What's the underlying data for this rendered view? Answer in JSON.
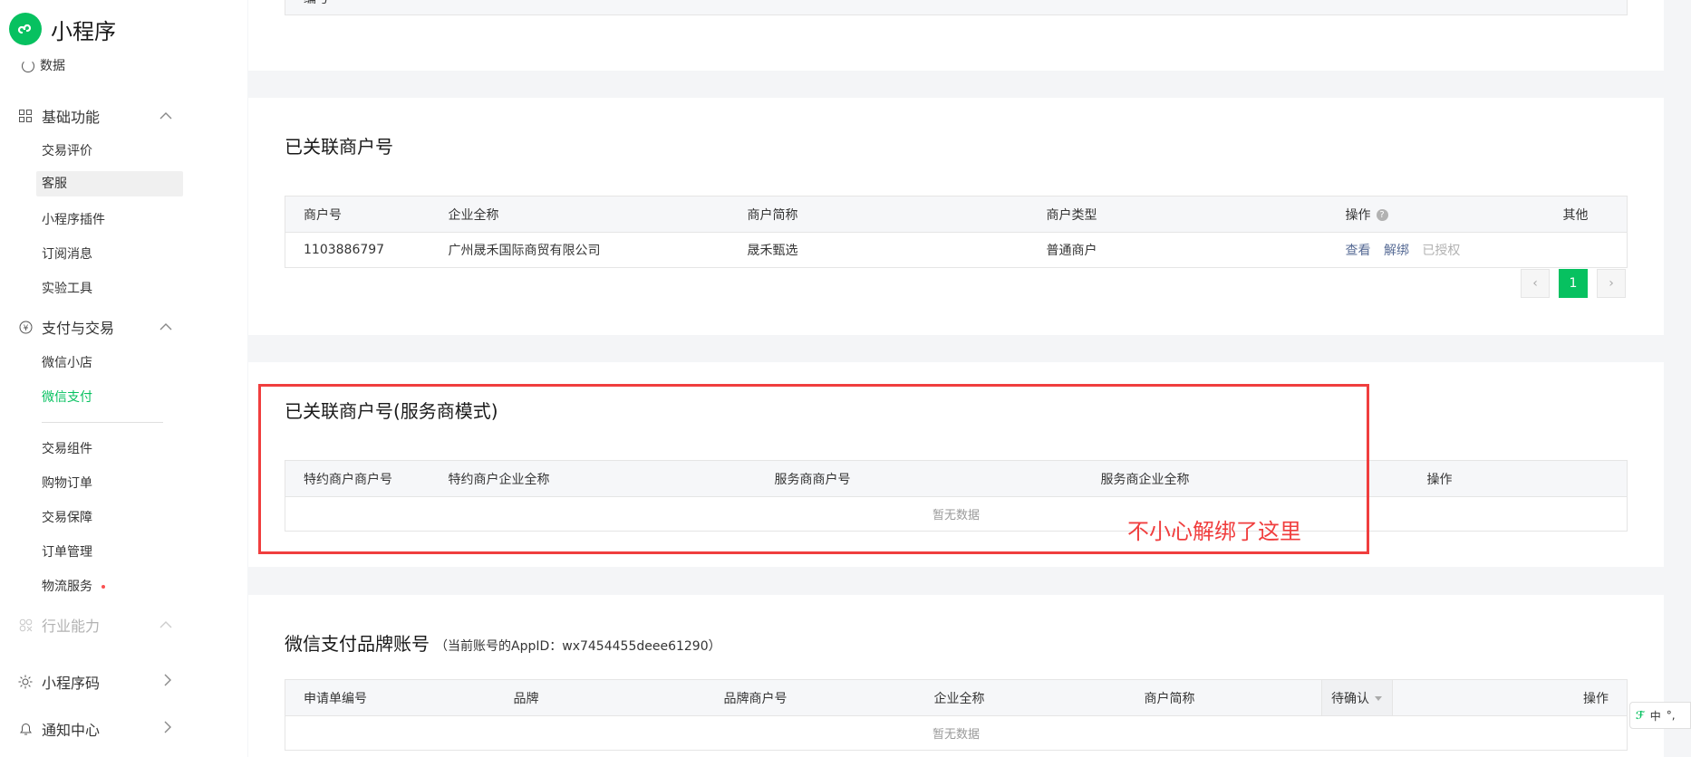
{
  "app": {
    "name": "小程序"
  },
  "sidebar": {
    "data_item": "数据",
    "groups": [
      {
        "label": "基础功能",
        "items": [
          "交易评价",
          "客服",
          "小程序插件",
          "订阅消息",
          "实验工具"
        ]
      },
      {
        "label": "支付与交易",
        "items": [
          "微信小店",
          "微信支付",
          "交易组件",
          "购物订单",
          "交易保障",
          "订单管理",
          "物流服务"
        ]
      },
      {
        "label": "行业能力"
      },
      {
        "label": "小程序码"
      },
      {
        "label": "通知中心"
      }
    ]
  },
  "top_table": {
    "partial_header": "编号"
  },
  "linked_merchants": {
    "title": "已关联商户号",
    "columns": [
      "商户号",
      "企业全称",
      "商户简称",
      "商户类型",
      "操作",
      "其他"
    ],
    "rows": [
      {
        "merchant_id": "1103886797",
        "company": "广州晟禾国际商贸有限公司",
        "short_name": "晟禾甄选",
        "type": "普通商户",
        "actions": [
          "查看",
          "解绑",
          "已授权"
        ]
      }
    ],
    "pager": {
      "prev": "‹",
      "current": "1",
      "next": "›"
    }
  },
  "service_provider": {
    "title": "已关联商户号(服务商模式)",
    "columns": [
      "特约商户商户号",
      "特约商户企业全称",
      "服务商商户号",
      "服务商企业全称",
      "操作"
    ],
    "empty_text": "暂无数据"
  },
  "annotation": {
    "text": "不小心解绑了这里",
    "color": "#f03e3e"
  },
  "brand_account": {
    "title": "微信支付品牌账号",
    "appid_note": "（当前账号的AppID：wx7454455deee61290）",
    "columns": [
      "申请单编号",
      "品牌",
      "品牌商户号",
      "企业全称",
      "商户简称",
      "待确认",
      "操作"
    ],
    "empty_text": "暂无数据"
  },
  "ime": {
    "lang": "中",
    "extra": "°,"
  },
  "colors": {
    "brand_green": "#07c160",
    "link": "#576b95",
    "annotation_red": "#f03e3e"
  }
}
